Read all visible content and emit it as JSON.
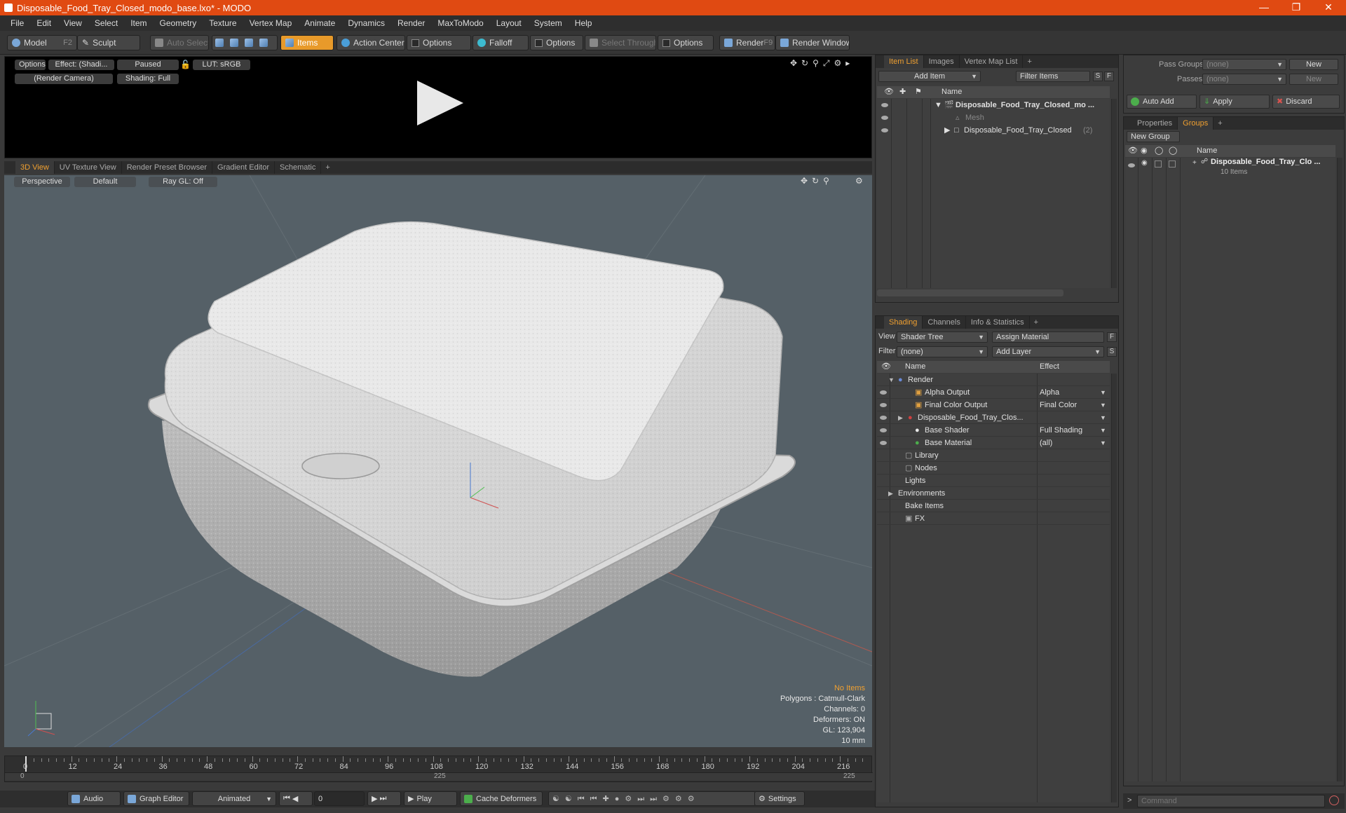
{
  "window": {
    "title": "Disposable_Food_Tray_Closed_modo_base.lxo* - MODO"
  },
  "menu": [
    "File",
    "Edit",
    "View",
    "Select",
    "Item",
    "Geometry",
    "Texture",
    "Vertex Map",
    "Animate",
    "Dynamics",
    "Render",
    "MaxToModo",
    "Layout",
    "System",
    "Help"
  ],
  "toolbar": {
    "model": "Model",
    "model_key": "F2",
    "sculpt": "Sculpt",
    "auto_select": "Auto Select",
    "items": "Items",
    "action_center": "Action Center",
    "options1": "Options",
    "falloff": "Falloff",
    "options2": "Options",
    "select_through": "Select Through",
    "options3": "Options",
    "render": "Render",
    "render_key": "F9",
    "render_window": "Render Window"
  },
  "preview": {
    "options": "Options",
    "effect": "Effect: (Shadi...",
    "paused": "Paused",
    "lut": "LUT: sRGB",
    "camera": "(Render Camera)",
    "shading": "Shading: Full"
  },
  "view_tabs": [
    "3D View",
    "UV Texture View",
    "Render Preset Browser",
    "Gradient Editor",
    "Schematic"
  ],
  "viewport": {
    "perspective": "Perspective",
    "default": "Default",
    "raygl": "Ray GL: Off",
    "info": {
      "no_items": "No Items",
      "polygons": "Polygons : Catmull-Clark",
      "channels": "Channels: 0",
      "deformers": "Deformers: ON",
      "gl": "GL: 123,904",
      "scale": "10 mm"
    }
  },
  "timeline": {
    "ticks": [
      "0",
      "12",
      "24",
      "36",
      "48",
      "60",
      "72",
      "84",
      "96",
      "108",
      "120",
      "132",
      "144",
      "156",
      "168",
      "180",
      "192",
      "204",
      "216"
    ],
    "range_start": "0",
    "range_mid": "225",
    "range_end": "225"
  },
  "bottombar": {
    "audio": "Audio",
    "graph_editor": "Graph Editor",
    "animated": "Animated",
    "frame": "0",
    "play": "Play",
    "cache_deformers": "Cache Deformers",
    "settings": "Settings"
  },
  "item_list": {
    "tabs": [
      "Item List",
      "Images",
      "Vertex Map List"
    ],
    "add_item": "Add Item",
    "filter_items": "Filter Items",
    "s_btn": "S",
    "f_btn": "F",
    "col_name": "Name",
    "rows": [
      {
        "label": "Disposable_Food_Tray_Closed_mo ...",
        "bold": true
      },
      {
        "label": "Mesh",
        "dim": true
      },
      {
        "label": "Disposable_Food_Tray_Closed",
        "count": "(2)"
      }
    ]
  },
  "shading": {
    "tabs": [
      "Shading",
      "Channels",
      "Info & Statistics"
    ],
    "view_label": "View",
    "view_value": "Shader Tree",
    "assign_material": "Assign Material",
    "filter_label": "Filter",
    "filter_value": "(none)",
    "add_layer": "Add Layer",
    "col_name": "Name",
    "col_effect": "Effect",
    "rows": [
      {
        "label": "Render",
        "effect": ""
      },
      {
        "label": "Alpha Output",
        "effect": "Alpha"
      },
      {
        "label": "Final Color Output",
        "effect": "Final Color"
      },
      {
        "label": "Disposable_Food_Tray_Clos...",
        "effect": ""
      },
      {
        "label": "Base Shader",
        "effect": "Full Shading"
      },
      {
        "label": "Base Material",
        "effect": "(all)"
      },
      {
        "label": "Library",
        "effect": ""
      },
      {
        "label": "Nodes",
        "effect": ""
      },
      {
        "label": "Lights",
        "effect": ""
      },
      {
        "label": "Environments",
        "effect": ""
      },
      {
        "label": "Bake Items",
        "effect": ""
      },
      {
        "label": "FX",
        "effect": ""
      }
    ]
  },
  "passes": {
    "pass_groups_label": "Pass Groups",
    "pass_groups_value": "(none)",
    "passes_label": "Passes",
    "passes_value": "(none)",
    "new1": "New",
    "new2": "New",
    "auto_add": "Auto Add",
    "apply": "Apply",
    "discard": "Discard"
  },
  "groups": {
    "tabs": [
      "Properties",
      "Groups"
    ],
    "new_group": "New Group",
    "col_name": "Name",
    "group_name": "Disposable_Food_Tray_Clo ...",
    "group_count": "10 Items"
  },
  "command": {
    "placeholder": "Command"
  },
  "colors": {
    "accent": "#e04a12",
    "active_tab": "#f0a030",
    "viewport_bg": "#556067"
  }
}
